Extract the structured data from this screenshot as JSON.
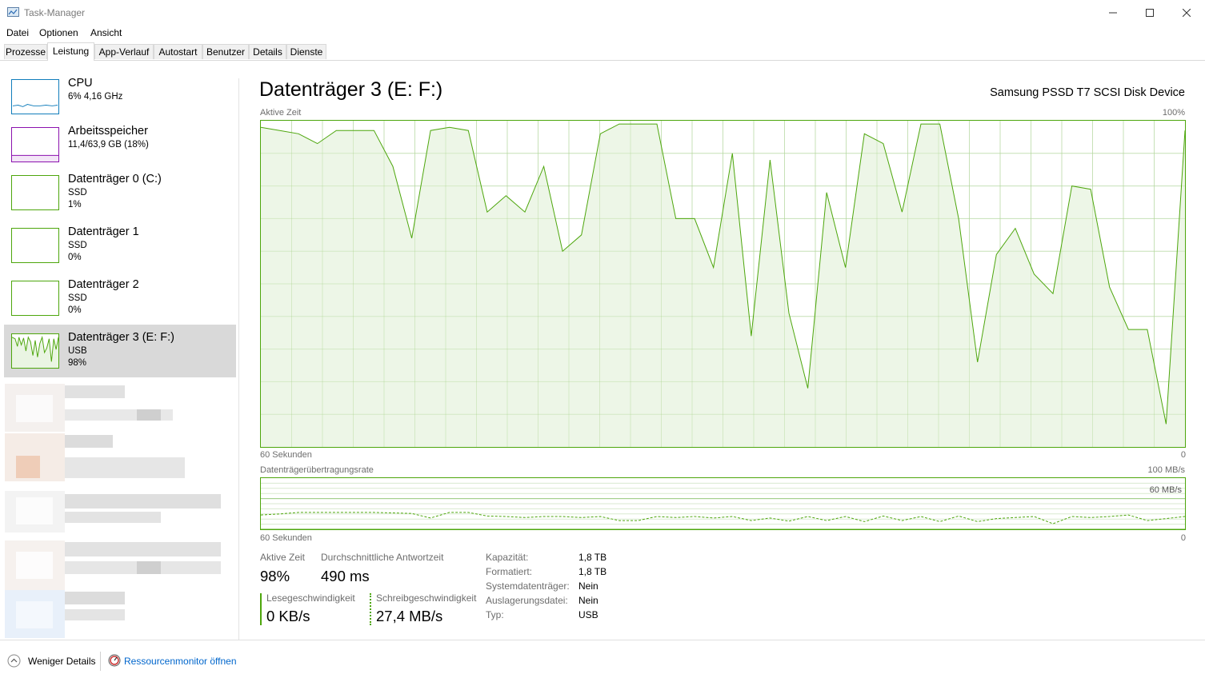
{
  "window": {
    "title": "Task-Manager"
  },
  "menu": [
    "Datei",
    "Optionen",
    "Ansicht"
  ],
  "tabs": [
    "Prozesse",
    "Leistung",
    "App-Verlauf",
    "Autostart",
    "Benutzer",
    "Details",
    "Dienste"
  ],
  "active_tab": "Leistung",
  "sidebar": {
    "items": [
      {
        "title": "CPU",
        "sub1": "6% 4,16 GHz",
        "sub2": ""
      },
      {
        "title": "Arbeitsspeicher",
        "sub1": "11,4/63,9 GB (18%)",
        "sub2": ""
      },
      {
        "title": "Datenträger 0 (C:)",
        "sub1": "SSD",
        "sub2": "1%"
      },
      {
        "title": "Datenträger 1",
        "sub1": "SSD",
        "sub2": "0%"
      },
      {
        "title": "Datenträger 2",
        "sub1": "SSD",
        "sub2": "0%"
      },
      {
        "title": "Datenträger 3 (E: F:)",
        "sub1": "USB",
        "sub2": "98%"
      }
    ],
    "selected_index": 5
  },
  "main": {
    "title": "Datenträger 3 (E: F:)",
    "device": "Samsung PSSD T7 SCSI Disk Device",
    "graph1": {
      "label": "Aktive Zeit",
      "max_label": "100%",
      "time_label": "60 Sekunden",
      "min_label": "0"
    },
    "graph2": {
      "label": "Datenträgerübertragungsrate",
      "max_label": "100 MB/s",
      "mid_label": "60 MB/s",
      "time_label": "60 Sekunden",
      "min_label": "0"
    },
    "stats": {
      "active_time_label": "Aktive Zeit",
      "active_time": "98%",
      "resp_label": "Durchschnittliche Antwortzeit",
      "resp": "490 ms",
      "read_label": "Lesegeschwindigkeit",
      "read": "0 KB/s",
      "write_label": "Schreibgeschwindigkeit",
      "write": "27,4 MB/s"
    },
    "props": [
      {
        "key": "Kapazität:",
        "value": "1,8 TB"
      },
      {
        "key": "Formatiert:",
        "value": "1,8 TB"
      },
      {
        "key": "Systemdatenträger:",
        "value": "Nein"
      },
      {
        "key": "Auslagerungsdatei:",
        "value": "Nein"
      },
      {
        "key": "Typ:",
        "value": "USB"
      }
    ]
  },
  "footer": {
    "less_details": "Weniger Details",
    "resource_monitor": "Ressourcenmonitor öffnen"
  },
  "colors": {
    "disk_green": "#4da60c",
    "fill_green": "#eaf5e3",
    "cpu_blue": "#117dbb",
    "mem_purple": "#8b12ae",
    "link_blue": "#0066cc"
  },
  "chart_data": [
    {
      "type": "area",
      "title": "Aktive Zeit",
      "ylabel": "%",
      "ylim": [
        0,
        100
      ],
      "x_range_seconds": 60,
      "values": [
        98,
        97,
        96,
        93,
        97,
        97,
        97,
        86,
        64,
        97,
        98,
        97,
        72,
        77,
        72,
        86,
        60,
        65,
        96,
        99,
        99,
        99,
        70,
        70,
        55,
        90,
        34,
        88,
        41,
        18,
        78,
        55,
        96,
        93,
        72,
        99,
        99,
        70,
        26,
        59,
        67,
        53,
        47,
        80,
        79,
        49,
        36,
        36,
        7,
        97
      ]
    },
    {
      "type": "line",
      "title": "Datenträgerübertragungsrate",
      "ylabel": "MB/s",
      "ylim": [
        0,
        100
      ],
      "series": [
        {
          "values": [
            28,
            30,
            33,
            33,
            33,
            33,
            33,
            32,
            31,
            22,
            33,
            33,
            26,
            25,
            23,
            25,
            25,
            23,
            25,
            17,
            17,
            25,
            23,
            25,
            22,
            25,
            17,
            22,
            16,
            25,
            17,
            25,
            15,
            26,
            17,
            25,
            15,
            26,
            15,
            21,
            23,
            25,
            11,
            25,
            23,
            25,
            28,
            17,
            21,
            25
          ]
        },
        {
          "values": [
            0,
            0,
            0,
            0,
            0,
            0,
            0,
            0,
            0,
            0,
            0,
            0,
            0,
            0,
            0,
            0,
            0,
            0,
            0,
            0,
            0,
            0,
            0,
            0,
            0,
            0,
            0,
            0,
            0,
            0,
            0,
            0,
            0,
            0,
            0,
            0,
            0,
            0,
            0,
            0,
            0,
            0,
            0,
            0,
            0,
            0,
            0,
            0,
            0,
            0
          ]
        }
      ]
    }
  ]
}
